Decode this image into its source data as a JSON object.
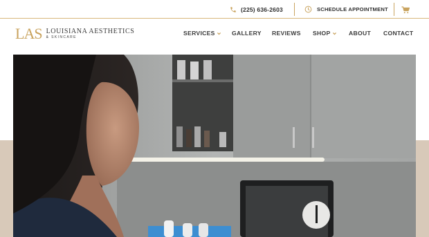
{
  "topbar": {
    "phone_icon": "phone-icon",
    "phone": "(225) 636-2603",
    "schedule_icon": "clock-icon",
    "schedule": "SCHEDULE APPOINTMENT",
    "cart_icon": "cart-icon"
  },
  "logo": {
    "mark": "LAS",
    "name": "LOUISIANA AESTHETICS",
    "sub": "& SKINCARE"
  },
  "nav": {
    "items": [
      {
        "label": "SERVICES",
        "dropdown": true
      },
      {
        "label": "GALLERY",
        "dropdown": false
      },
      {
        "label": "REVIEWS",
        "dropdown": false
      },
      {
        "label": "SHOP",
        "dropdown": true
      },
      {
        "label": "ABOUT",
        "dropdown": false
      },
      {
        "label": "CONTACT",
        "dropdown": false
      }
    ]
  },
  "colors": {
    "accent_gold": "#c9a35e",
    "text_dark": "#2d2d2d",
    "band_beige": "#d8c9b9"
  },
  "hero": {
    "image": "photo of smiling woman in clinic with cabinets, shelf of bottles and a tablet"
  }
}
